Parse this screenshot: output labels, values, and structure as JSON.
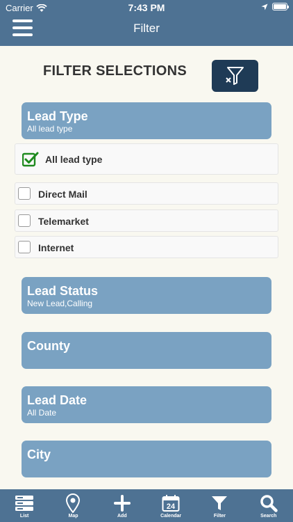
{
  "status_bar": {
    "carrier": "Carrier",
    "time": "7:43 PM",
    "battery_level": 1.0
  },
  "header": {
    "title": "Filter"
  },
  "main": {
    "heading": "FILTER SELECTIONS",
    "lead_type": {
      "title": "Lead Type",
      "subtitle": "All lead type",
      "options": [
        {
          "label": "All lead type",
          "checked": true
        },
        {
          "label": "Direct Mail",
          "checked": false
        },
        {
          "label": "Telemarket",
          "checked": false
        },
        {
          "label": "Internet",
          "checked": false
        }
      ]
    },
    "lead_status": {
      "title": "Lead Status",
      "subtitle": "New Lead,Calling"
    },
    "county": {
      "title": "County",
      "subtitle": ""
    },
    "lead_date": {
      "title": "Lead Date",
      "subtitle": "All Date"
    },
    "city": {
      "title": "City",
      "subtitle": ""
    }
  },
  "tabbar": {
    "items": [
      {
        "label": "List",
        "icon": "list-icon"
      },
      {
        "label": "Map",
        "icon": "map-pin-icon"
      },
      {
        "label": "Add",
        "icon": "plus-icon"
      },
      {
        "label": "Calendar",
        "icon": "calendar-icon",
        "day": "24"
      },
      {
        "label": "Filter",
        "icon": "filter-icon"
      },
      {
        "label": "Search",
        "icon": "search-icon"
      }
    ]
  },
  "colors": {
    "header": "#4e7293",
    "section": "#7aa2c2",
    "button": "#1f3b56",
    "check": "#1e8a1e"
  }
}
